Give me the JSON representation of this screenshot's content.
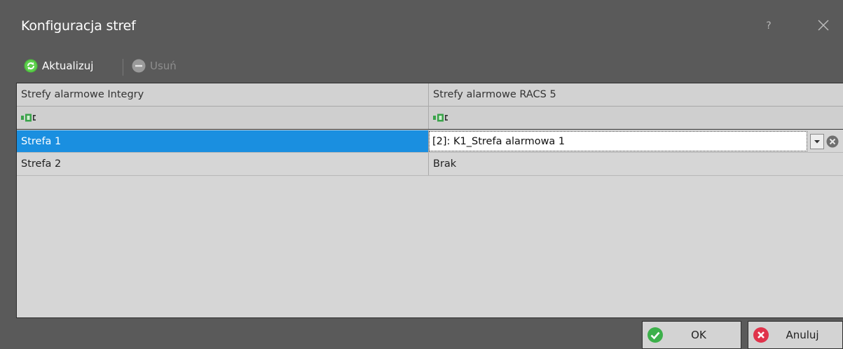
{
  "window": {
    "title": "Konfiguracja stref",
    "help_label": "?"
  },
  "toolbar": {
    "update_label": "Aktualizuj",
    "remove_label": "Usuń"
  },
  "grid": {
    "columns": [
      "Strefy alarmowe Integry",
      "Strefy alarmowe RACS 5"
    ],
    "rows": [
      {
        "integra": "Strefa  1",
        "racs": "[2]: K1_Strefa alarmowa 1"
      },
      {
        "integra": "Strefa  2",
        "racs": "Brak"
      }
    ]
  },
  "footer": {
    "ok_label": "OK",
    "cancel_label": "Anuluj"
  },
  "colors": {
    "selection": "#1a8fe0",
    "ok_green": "#3cb04a",
    "cancel_red": "#e0334b",
    "update_green": "#4cbf3c"
  }
}
